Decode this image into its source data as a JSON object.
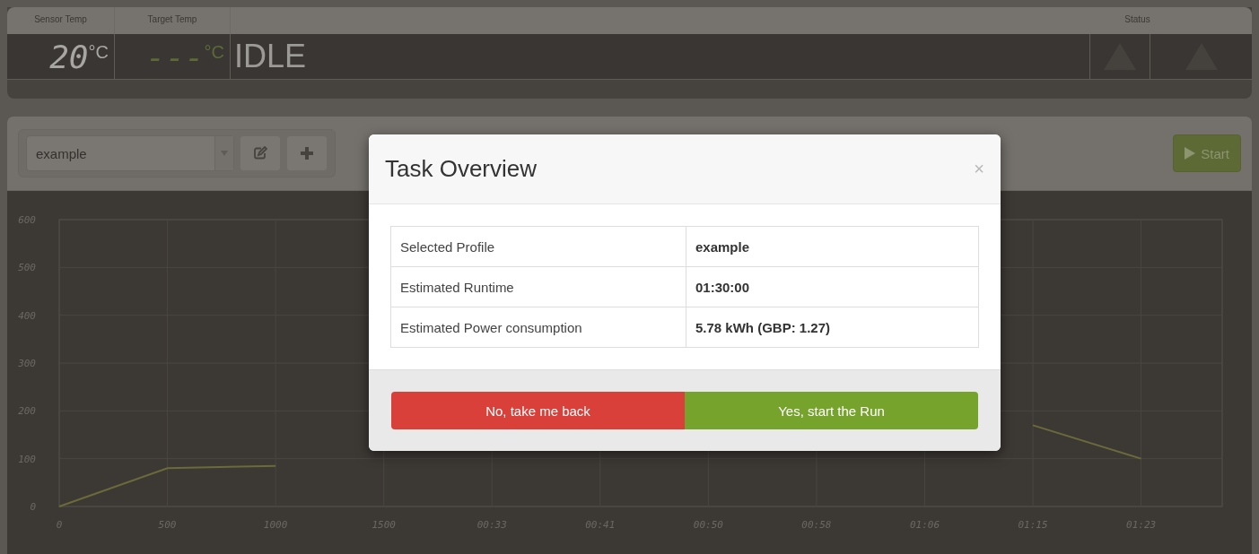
{
  "status_panel": {
    "headers": [
      "Sensor Temp",
      "Target Temp",
      "Status"
    ],
    "sensor": {
      "value": "20",
      "unit": "°C"
    },
    "target": {
      "value": "---",
      "unit": "°C"
    },
    "state": "IDLE",
    "status_icons": [
      {
        "kind": "warning"
      },
      {
        "kind": "warning"
      }
    ]
  },
  "toolbar": {
    "profile_select": {
      "value": "example"
    },
    "start_button": {
      "label": "Start"
    }
  },
  "chart": {
    "chart_data": {
      "type": "line",
      "categories": [
        "0",
        "500",
        "1000",
        "1500",
        "00:33",
        "00:41",
        "00:50",
        "00:58",
        "01:06",
        "01:15",
        "01:23"
      ],
      "ylim": [
        0,
        600
      ],
      "grid": true,
      "yticks": [
        0,
        100,
        200,
        300,
        400,
        500,
        600
      ],
      "series": [
        {
          "color": "#6b6a3a",
          "values": [
            0,
            80,
            85,
            null,
            null,
            null,
            null,
            null,
            null,
            170,
            100
          ]
        }
      ]
    }
  },
  "modal": {
    "title": "Task Overview",
    "close": "×",
    "rows": [
      {
        "label": "Selected Profile",
        "value": "example"
      },
      {
        "label": "Estimated Runtime",
        "value": "01:30:00"
      },
      {
        "label": "Estimated Power consumption",
        "value": "5.78 kWh (GBP: 1.27)"
      }
    ],
    "buttons": [
      {
        "kind": "cancel",
        "label": "No, take me back"
      },
      {
        "kind": "confirm",
        "label": "Yes, start the Run"
      }
    ]
  }
}
